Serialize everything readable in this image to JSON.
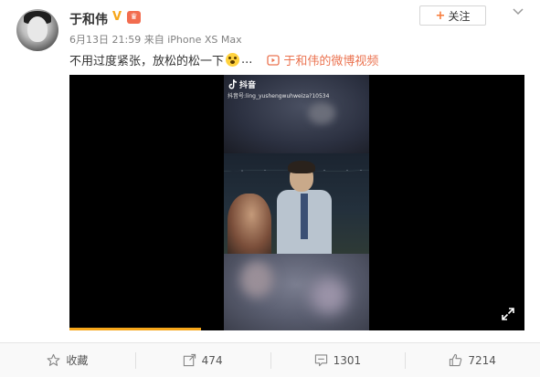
{
  "post": {
    "author": "于和伟",
    "badge_v": "V",
    "crown_icon": "vip-crown-icon",
    "follow_label": "关注",
    "date": "6月13日 21:59",
    "source_prefix": "来自",
    "source_device": "iPhone XS Max",
    "text": "不用过度紧张，放松的松一下",
    "ellipsis": "...",
    "video_link_text": "于和伟的微博视频"
  },
  "video": {
    "overlay_brand": "抖音",
    "overlay_id": "抖音号:ling_yushengwuhweiza?10534",
    "progress_fraction": 0.29
  },
  "actions": [
    {
      "label": "收藏",
      "icon": "star-icon"
    },
    {
      "label": "474",
      "icon": "share-icon"
    },
    {
      "label": "1301",
      "icon": "comment-icon"
    },
    {
      "label": "7214",
      "icon": "like-icon"
    }
  ],
  "colors": {
    "accent": "#eb7350",
    "progress": "#f7a71b",
    "badge": "#f7a71b"
  }
}
